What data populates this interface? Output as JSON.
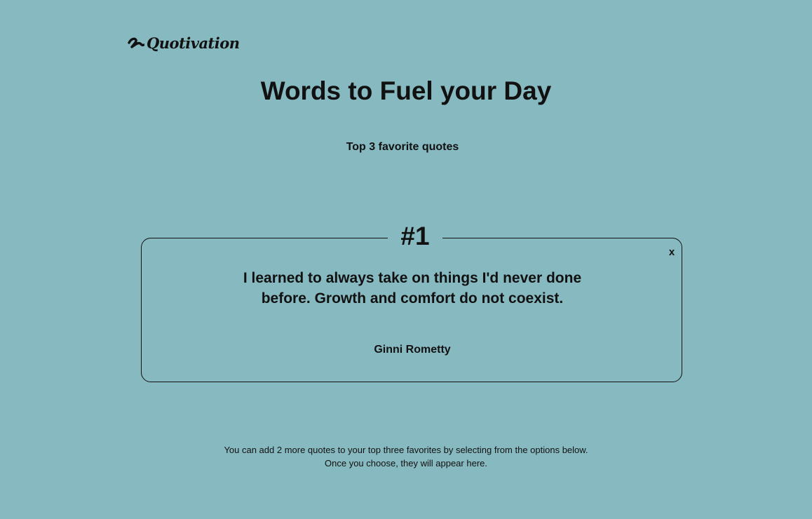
{
  "header": {
    "brand": "Quotivation",
    "title": "Words to Fuel your Day",
    "subtitle": "Top 3 favorite quotes"
  },
  "favorites": [
    {
      "rank": "#1",
      "text": "I learned to always take on things I'd never done before. Growth and comfort do not coexist.",
      "author": "Ginni Rometty",
      "remove_label": "x"
    }
  ],
  "footer": {
    "line1": "You can add 2 more quotes to your top three favorites by selecting from the options below.",
    "line2": "Once you choose, they will appear here."
  },
  "colors": {
    "background": "#87b9c0",
    "text": "#111111"
  },
  "icons": {
    "logo": "squiggle-logo-icon"
  }
}
